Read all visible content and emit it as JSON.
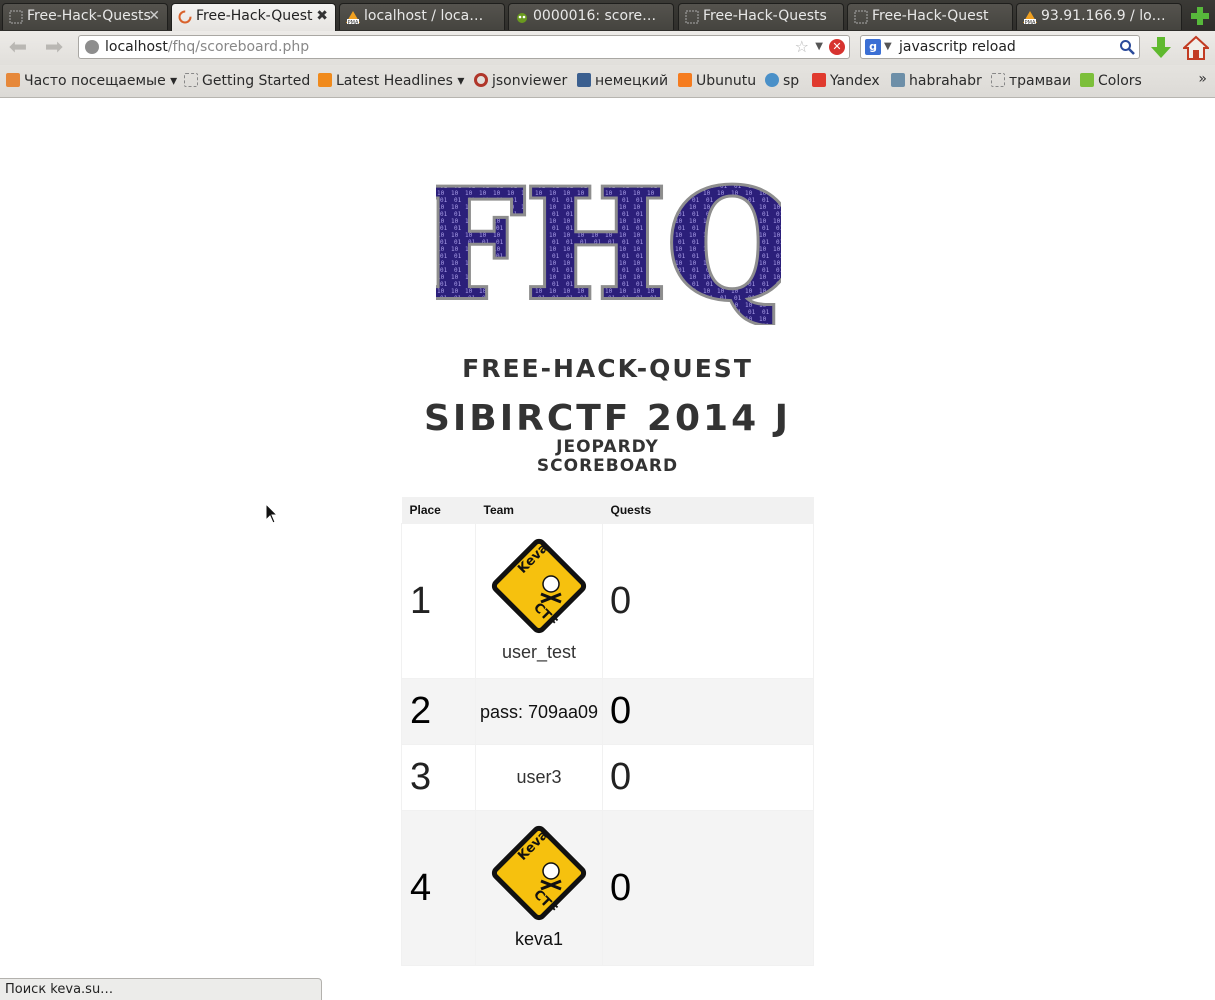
{
  "browser": {
    "tabs": [
      {
        "label": "Free-Hack-Quests",
        "active": false
      },
      {
        "label": "Free-Hack-Quest",
        "active": true
      },
      {
        "label": "localhost / loca…",
        "active": false
      },
      {
        "label": "0000016: score…",
        "active": false
      },
      {
        "label": "Free-Hack-Quests",
        "active": false
      },
      {
        "label": "Free-Hack-Quest",
        "active": false
      },
      {
        "label": "93.91.166.9 / lo…",
        "active": false
      }
    ],
    "url_host": "localhost",
    "url_path": "/fhq/scoreboard.php",
    "search_value": "javascritp reload",
    "bookmarks": [
      {
        "label": "Часто посещаемые ▾",
        "icon": "most-visited-icon"
      },
      {
        "label": "Getting Started",
        "icon": "page-icon"
      },
      {
        "label": "Latest Headlines ▾",
        "icon": "rss-icon"
      },
      {
        "label": "jsonviewer",
        "icon": "jsonviewer-icon"
      },
      {
        "label": "немецкий",
        "icon": "vk-icon"
      },
      {
        "label": "Ubunutu",
        "icon": "blogger-icon"
      },
      {
        "label": "sp",
        "icon": "sp-icon"
      },
      {
        "label": "Yandex",
        "icon": "yandex-icon"
      },
      {
        "label": "habrahabr",
        "icon": "habr-icon"
      },
      {
        "label": "трамваи",
        "icon": "page-icon"
      },
      {
        "label": "Colors",
        "icon": "colors-icon"
      }
    ],
    "status_text": "Поиск keva.su…"
  },
  "page": {
    "logo_text": "FHQ",
    "title": "FREE-HACK-QUEST",
    "event": "SIBIRCTF 2014 J",
    "subtitle_1": "JEOPARDY",
    "subtitle_2": "SCOREBOARD"
  },
  "scoreboard": {
    "headers": {
      "place": "Place",
      "team": "Team",
      "quests": "Quests"
    },
    "rows": [
      {
        "place": "1",
        "team": "user_test",
        "quests": "0",
        "logo": "keva-ctf-logo"
      },
      {
        "place": "2",
        "team": "pass: 709aa09",
        "quests": "0",
        "logo": ""
      },
      {
        "place": "3",
        "team": "user3",
        "quests": "0",
        "logo": ""
      },
      {
        "place": "4",
        "team": "keva1",
        "quests": "0",
        "logo": "keva-ctf-logo"
      }
    ],
    "logo_text_1": "Keva",
    "logo_text_2": "CTF"
  },
  "colors": {
    "logo_fill": "#2b1f7a",
    "keva_yellow": "#f6c10e"
  }
}
